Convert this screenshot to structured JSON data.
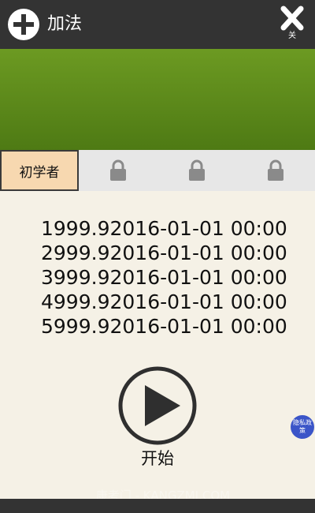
{
  "header": {
    "title": "加法",
    "close_label": "关"
  },
  "tabs": [
    {
      "label": "初学者",
      "locked": false
    },
    {
      "label": "",
      "locked": true
    },
    {
      "label": "",
      "locked": true
    },
    {
      "label": "",
      "locked": true
    }
  ],
  "scores": [
    {
      "rank": "1",
      "score": "999.9",
      "date": "2016-01-01 00:00"
    },
    {
      "rank": "2",
      "score": "999.9",
      "date": "2016-01-01 00:00"
    },
    {
      "rank": "3",
      "score": "999.9",
      "date": "2016-01-01 00:00"
    },
    {
      "rank": "4",
      "score": "999.9",
      "date": "2016-01-01 00:00"
    },
    {
      "rank": "5",
      "score": "999.9",
      "date": "2016-01-01 00:00"
    }
  ],
  "start_label": "开始",
  "privacy_label": "隐私政策",
  "watermark": "康考门 - KANGZMI.COM",
  "colors": {
    "header_bg": "#333333",
    "banner_green": "#5f8c1c",
    "tab_active_bg": "#f7d8b0",
    "page_bg": "#f5f1e6",
    "privacy_blue": "#3b55c8"
  },
  "icons": [
    "plus-circle-icon",
    "close-x-icon",
    "lock-icon",
    "play-icon"
  ]
}
